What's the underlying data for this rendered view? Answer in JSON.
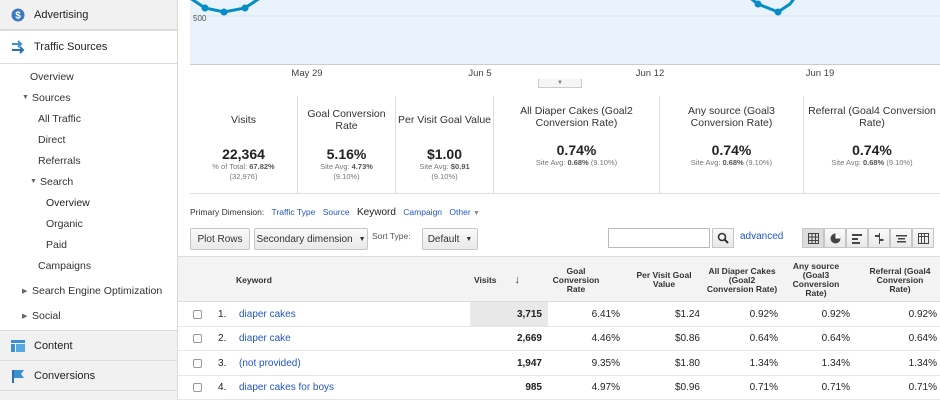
{
  "sidebar": {
    "advertising": "Advertising",
    "traffic_sources": "Traffic Sources",
    "overview": "Overview",
    "sources": "Sources",
    "all_traffic": "All Traffic",
    "direct": "Direct",
    "referrals": "Referrals",
    "search": "Search",
    "search_overview": "Overview",
    "organic": "Organic",
    "paid": "Paid",
    "campaigns": "Campaigns",
    "seo": "Search Engine Optimization",
    "social": "Social",
    "content": "Content",
    "conversions": "Conversions"
  },
  "chart": {
    "y_label": "500",
    "x_ticks": [
      "May 29",
      "Jun 5",
      "Jun 12",
      "Jun 19"
    ],
    "line_color": "#058dc7",
    "area_color": "#eaf3fb"
  },
  "metrics": [
    {
      "name": "Visits",
      "value": "22,364",
      "sub1_prefix": "% of Total: ",
      "sub1_bold": "67.82%",
      "sub2": "(32,976)"
    },
    {
      "name": "Goal Conversion Rate",
      "value": "5.16%",
      "sub1_prefix": "Site Avg: ",
      "sub1_bold": "4.73%",
      "sub2": "(9.10%)"
    },
    {
      "name": "Per Visit Goal Value",
      "value": "$1.00",
      "sub1_prefix": "Site Avg: ",
      "sub1_bold": "$0.91",
      "sub2": "(9.10%)"
    },
    {
      "name": "All Diaper Cakes (Goal2 Conversion Rate)",
      "value": "0.74%",
      "sub1_prefix": "Site Avg: ",
      "sub1_bold": "0.68%",
      "sub2": "(9.10%)"
    },
    {
      "name": "Any source (Goal3 Conversion Rate)",
      "value": "0.74%",
      "sub1_prefix": "Site Avg: ",
      "sub1_bold": "0.68%",
      "sub2": "(9.10%)"
    },
    {
      "name": "Referral (Goal4 Conversion Rate)",
      "value": "0.74%",
      "sub1_prefix": "Site Avg: ",
      "sub1_bold": "0.68%",
      "sub2": "(9.10%)"
    }
  ],
  "dimension": {
    "label": "Primary Dimension:",
    "traffic_type": "Traffic Type",
    "source": "Source",
    "keyword": "Keyword",
    "campaign": "Campaign",
    "other": "Other"
  },
  "toolbar": {
    "plot_rows": "Plot Rows",
    "secondary": "Secondary dimension",
    "sort_label": "Sort Type:",
    "sort_value": "Default",
    "search_value": "",
    "advanced": "advanced"
  },
  "table": {
    "headers": {
      "keyword": "Keyword",
      "visits": "Visits",
      "goal_conv": "Goal Conversion Rate",
      "per_visit": "Per Visit Goal Value",
      "goal2": "All Diaper Cakes (Goal2 Conversion Rate)",
      "goal3": "Any source (Goal3 Conversion Rate)",
      "goal4": "Referral (Goal4 Conversion Rate)"
    },
    "rows": [
      {
        "idx": "1.",
        "keyword": "diaper cakes",
        "visits": "3,715",
        "gcr": "6.41%",
        "pvgv": "$1.24",
        "g2": "0.92%",
        "g3": "0.92%",
        "g4": "0.92%"
      },
      {
        "idx": "2.",
        "keyword": "diaper cake",
        "visits": "2,669",
        "gcr": "4.46%",
        "pvgv": "$0.86",
        "g2": "0.64%",
        "g3": "0.64%",
        "g4": "0.64%"
      },
      {
        "idx": "3.",
        "keyword": "(not provided)",
        "visits": "1,947",
        "gcr": "9.35%",
        "pvgv": "$1.80",
        "g2": "1.34%",
        "g3": "1.34%",
        "g4": "1.34%"
      },
      {
        "idx": "4.",
        "keyword": "diaper cakes for boys",
        "visits": "985",
        "gcr": "4.97%",
        "pvgv": "$0.96",
        "g2": "0.71%",
        "g3": "0.71%",
        "g4": "0.71%"
      }
    ]
  }
}
